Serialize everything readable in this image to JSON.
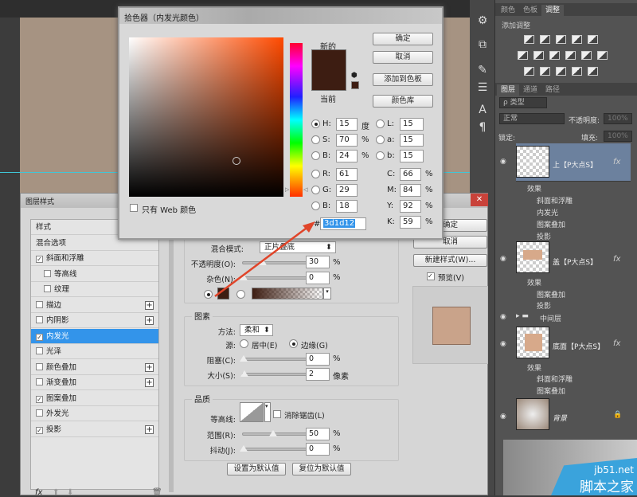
{
  "colors": {
    "accent": "#3394ea",
    "new_color": "#3d1d12",
    "current_color": "#3d1d12",
    "arrow": "#e0452a",
    "canvas": "#a69382",
    "selected_layer": "#6c819e"
  },
  "right_panel": {
    "top_tabs": [
      "颜色",
      "色板",
      "调整"
    ],
    "adjust_title": "添加调整",
    "layer_tabs": [
      "图层",
      "通道",
      "路径"
    ],
    "filter_kind": "ρ 类型",
    "blend_mode": "正常",
    "opacity_label": "不透明度:",
    "opacity_value": "100%",
    "lock_label": "锁定:",
    "fill_label": "填充:",
    "fill_value": "100%",
    "layers": [
      {
        "name": "上【P大点S】",
        "effects_label": "效果",
        "effects": [
          "斜面和浮雕",
          "内发光",
          "图案叠加",
          "投影"
        ]
      },
      {
        "name": "盖【P大点S】",
        "effects_label": "效果",
        "effects": [
          "图案叠加",
          "投影"
        ]
      },
      {
        "name": "中间层"
      },
      {
        "name": "底面【P大点S】",
        "effects_label": "效果",
        "effects": [
          "斜面和浮雕",
          "图案叠加"
        ]
      },
      {
        "name": "背景"
      }
    ]
  },
  "layer_style": {
    "title": "图层样式",
    "list": [
      {
        "label": "样式",
        "check": null
      },
      {
        "label": "混合选项",
        "check": null
      },
      {
        "label": "斜面和浮雕",
        "check": true
      },
      {
        "label": "等高线",
        "check": false,
        "indent": true
      },
      {
        "label": "纹理",
        "check": false,
        "indent": true
      },
      {
        "label": "描边",
        "check": false,
        "plus": true
      },
      {
        "label": "内阴影",
        "check": false,
        "plus": true
      },
      {
        "label": "内发光",
        "check": true,
        "selected": true
      },
      {
        "label": "光泽",
        "check": false
      },
      {
        "label": "颜色叠加",
        "check": false,
        "plus": true
      },
      {
        "label": "渐变叠加",
        "check": false,
        "plus": true
      },
      {
        "label": "图案叠加",
        "check": true
      },
      {
        "label": "外发光",
        "check": false
      },
      {
        "label": "投影",
        "check": true,
        "plus": true
      }
    ],
    "footer_fx": "fx",
    "structure": {
      "blend_mode_label": "混合模式:",
      "blend_mode": "正片叠底",
      "opacity_label": "不透明度(O):",
      "opacity": "30",
      "noise_label": "杂色(N):",
      "noise": "0",
      "pct": "%"
    },
    "elements": {
      "title": "图素",
      "method_label": "方法:",
      "method": "柔和",
      "source_label": "源:",
      "center": "居中(E)",
      "edge": "边缘(G)",
      "choke_label": "阻塞(C):",
      "choke": "0",
      "size_label": "大小(S):",
      "size": "2",
      "px": "像素"
    },
    "quality": {
      "title": "品质",
      "contour_label": "等高线:",
      "antialias": "消除锯齿(L)",
      "range_label": "范围(R):",
      "range": "50",
      "jitter_label": "抖动(J):",
      "jitter": "0"
    },
    "set_default": "设置为默认值",
    "reset_default": "复位为默认值",
    "ok": "确定",
    "cancel": "取消",
    "new_style": "新建样式(W)...",
    "preview": "预览(V)"
  },
  "picker": {
    "title": "拾色器（内发光颜色）",
    "new_label": "新的",
    "current_label": "当前",
    "ok": "确定",
    "cancel": "取消",
    "add_swatch": "添加到色板",
    "libraries": "颜色库",
    "web_only": "只有 Web 颜色",
    "H": "15",
    "S": "70",
    "Bv": "24",
    "R": "61",
    "G": "29",
    "Bb": "18",
    "L": "15",
    "a": "15",
    "b": "15",
    "C": "66",
    "M": "84",
    "Y": "92",
    "K": "59",
    "deg": "度",
    "pct": "%",
    "hash": "#",
    "hex": "3d1d12",
    "labels": {
      "H": "H:",
      "S": "S:",
      "B": "B:",
      "R": "R:",
      "G": "G:",
      "Bb": "B:",
      "L": "L:",
      "a": "a:",
      "b": "b:",
      "C": "C:",
      "M": "M:",
      "Y": "Y:",
      "K": "K:"
    }
  },
  "watermark": {
    "site": "jb51.net",
    "name": "脚本之家"
  }
}
